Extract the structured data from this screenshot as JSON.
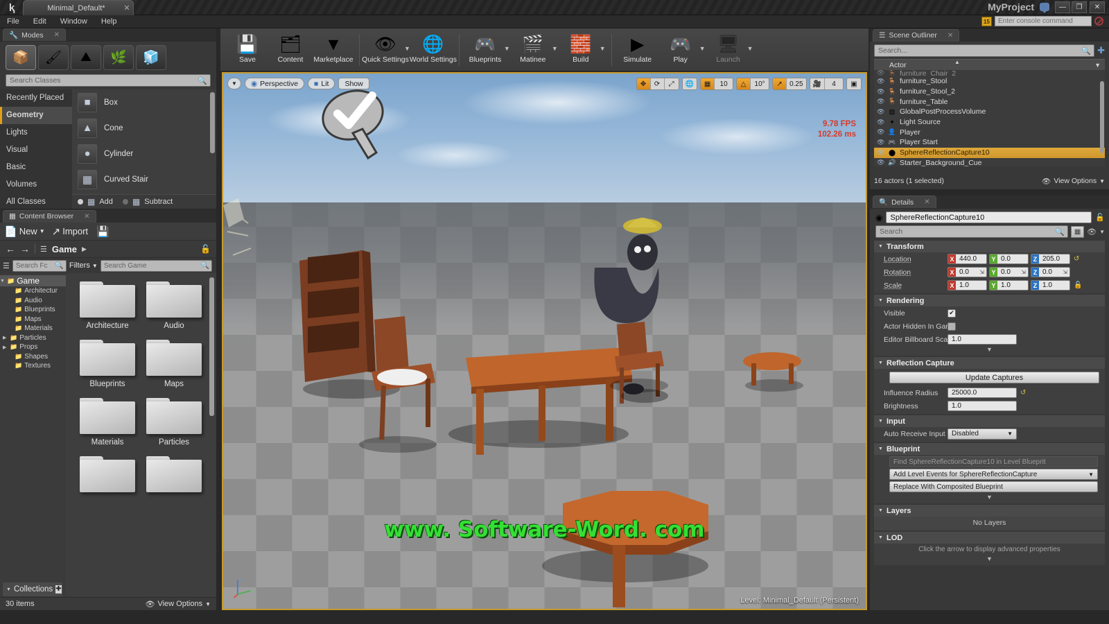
{
  "titlebar": {
    "tab_label": "Minimal_Default*",
    "tab_close": "✕",
    "project_title": "MyProject",
    "minimize": "—",
    "maximize": "❐",
    "close": "✕"
  },
  "menubar": {
    "items": [
      "File",
      "Edit",
      "Window",
      "Help"
    ],
    "console_badge": "15",
    "console_placeholder": "Enter console command"
  },
  "modes": {
    "tab_title": "Modes",
    "tab_close": "✕",
    "mode_buttons": [
      {
        "name": "place-mode",
        "glyph": "📦"
      },
      {
        "name": "paint-mode",
        "glyph": "🖌"
      },
      {
        "name": "landscape-mode",
        "glyph": "⛰"
      },
      {
        "name": "foliage-mode",
        "glyph": "🌿"
      },
      {
        "name": "geometry-editing-mode",
        "glyph": "🧊"
      }
    ],
    "search_placeholder": "Search Classes",
    "categories": [
      {
        "label": "Recently Placed",
        "active": false
      },
      {
        "label": "Geometry",
        "active": true
      },
      {
        "label": "Lights",
        "active": false
      },
      {
        "label": "Visual",
        "active": false
      },
      {
        "label": "Basic",
        "active": false
      },
      {
        "label": "Volumes",
        "active": false
      },
      {
        "label": "All Classes",
        "active": false
      }
    ],
    "items": [
      {
        "label": "Box",
        "glyph": "⬛"
      },
      {
        "label": "Cone",
        "glyph": "▲"
      },
      {
        "label": "Cylinder",
        "glyph": "⬮"
      },
      {
        "label": "Curved Stair",
        "glyph": "▤"
      }
    ],
    "csg_add_label": "Add",
    "csg_subtract_label": "Subtract"
  },
  "content_browser": {
    "tab_title": "Content Browser",
    "tab_close": "✕",
    "new_label": "New",
    "import_label": "Import",
    "save_all_icon": "save-all-icon",
    "path_root": "Game",
    "folder_search_placeholder": "Search Fc",
    "filters_label": "Filters",
    "asset_search_placeholder": "Search Game",
    "tree": [
      {
        "label": "Game",
        "depth": 0,
        "expandable": true
      },
      {
        "label": "Architectur",
        "depth": 1,
        "expandable": false
      },
      {
        "label": "Audio",
        "depth": 1,
        "expandable": false
      },
      {
        "label": "Blueprints",
        "depth": 1,
        "expandable": false
      },
      {
        "label": "Maps",
        "depth": 1,
        "expandable": false
      },
      {
        "label": "Materials",
        "depth": 1,
        "expandable": false
      },
      {
        "label": "Particles",
        "depth": 1,
        "expandable": true
      },
      {
        "label": "Props",
        "depth": 1,
        "expandable": true
      },
      {
        "label": "Shapes",
        "depth": 1,
        "expandable": false
      },
      {
        "label": "Textures",
        "depth": 1,
        "expandable": false
      }
    ],
    "tiles": [
      "Architecture",
      "Audio",
      "Blueprints",
      "Maps",
      "Materials",
      "Particles",
      "",
      ""
    ],
    "collections_label": "Collections",
    "collections_add": "✚",
    "item_count": "30 items",
    "view_options": "View Options"
  },
  "toolbar": {
    "groups": [
      [
        {
          "label": "Save",
          "icon": "save-icon",
          "glyph": "💾",
          "caret": false,
          "disabled": false
        },
        {
          "label": "Content",
          "icon": "content-icon",
          "glyph": "🗂",
          "caret": false,
          "disabled": false
        },
        {
          "label": "Marketplace",
          "icon": "marketplace-icon",
          "glyph": "⬇",
          "caret": false,
          "disabled": false
        }
      ],
      [
        {
          "label": "Quick Settings",
          "icon": "quick-settings-icon",
          "glyph": "👁",
          "caret": true,
          "disabled": false
        },
        {
          "label": "World Settings",
          "icon": "world-settings-icon",
          "glyph": "🌐",
          "caret": false,
          "disabled": false
        }
      ],
      [
        {
          "label": "Blueprints",
          "icon": "blueprints-icon",
          "glyph": "🎮",
          "caret": true,
          "disabled": false
        },
        {
          "label": "Matinee",
          "icon": "matinee-icon",
          "glyph": "🎬",
          "caret": true,
          "disabled": false
        },
        {
          "label": "Build",
          "icon": "build-icon",
          "glyph": "🧱",
          "caret": true,
          "disabled": false
        }
      ],
      [
        {
          "label": "Simulate",
          "icon": "simulate-icon",
          "glyph": "▶",
          "caret": false,
          "disabled": false
        },
        {
          "label": "Play",
          "icon": "play-icon",
          "glyph": "🎮",
          "caret": true,
          "disabled": false
        },
        {
          "label": "Launch",
          "icon": "launch-icon",
          "glyph": "🖥",
          "caret": true,
          "disabled": true
        }
      ]
    ]
  },
  "viewport": {
    "view_mode": "Perspective",
    "lighting_mode": "Lit",
    "show_label": "Show",
    "transform_tools": [
      {
        "name": "translate-tool",
        "glyph": "✥",
        "on": true
      },
      {
        "name": "rotate-tool",
        "glyph": "⟳",
        "on": false
      },
      {
        "name": "scale-tool",
        "glyph": "⤢",
        "on": false
      }
    ],
    "coord_system_glyph": "🌐",
    "grid_snap_glyph": "▦",
    "grid_snap_value": "10",
    "angle_snap_glyph": "△",
    "angle_snap_value": "10°",
    "scale_snap_glyph": "↗",
    "scale_snap_value": "0.25",
    "camera_speed_glyph": "🎥",
    "camera_speed_value": "4",
    "fps": "9.78 FPS",
    "frame_time": "102.26 ms",
    "level_status": "Level:  Minimal_Default (Persistent)",
    "watermark": "www. Software-Word. com"
  },
  "outliner": {
    "tab_title": "Scene Outliner",
    "tab_close": "✕",
    "search_placeholder": "Search...",
    "column_actor": "Actor",
    "actors": [
      {
        "name": "furniture_Chair_2",
        "type_glyph": "🪑",
        "selected": false,
        "partial": true
      },
      {
        "name": "furniture_Stool",
        "type_glyph": "🪑",
        "selected": false
      },
      {
        "name": "furniture_Stool_2",
        "type_glyph": "🪑",
        "selected": false
      },
      {
        "name": "furniture_Table",
        "type_glyph": "🪑",
        "selected": false
      },
      {
        "name": "GlobalPostProcessVolume",
        "type_glyph": "▧",
        "selected": false
      },
      {
        "name": "Light Source",
        "type_glyph": "✦",
        "selected": false
      },
      {
        "name": "Player",
        "type_glyph": "👤",
        "selected": false
      },
      {
        "name": "Player Start",
        "type_glyph": "🎮",
        "selected": false
      },
      {
        "name": "SphereReflectionCapture10",
        "type_glyph": "⬤",
        "selected": true
      },
      {
        "name": "Starter_Background_Cue",
        "type_glyph": "🔊",
        "selected": false
      }
    ],
    "status": "16 actors (1 selected)",
    "view_options": "View Options"
  },
  "details": {
    "tab_title": "Details",
    "tab_close": "✕",
    "actor_name": "SphereReflectionCapture10",
    "search_placeholder": "Search",
    "sections": {
      "transform": {
        "title": "Transform",
        "rows": [
          {
            "label": "Location",
            "x": "440.0",
            "y": "0.0",
            "z": "205.0",
            "spinner": false,
            "reset": true
          },
          {
            "label": "Rotation",
            "x": "0.0",
            "y": "0.0",
            "z": "0.0",
            "spinner": true,
            "reset": false
          },
          {
            "label": "Scale",
            "x": "1.0",
            "y": "1.0",
            "z": "1.0",
            "spinner": false,
            "lock": true
          }
        ]
      },
      "rendering": {
        "title": "Rendering",
        "visible_label": "Visible",
        "visible_checked": true,
        "hidden_label": "Actor Hidden In Gar",
        "hidden_checked": false,
        "billboard_label": "Editor Billboard Sca",
        "billboard_value": "1.0"
      },
      "reflection_capture": {
        "title": "Reflection Capture",
        "update_button": "Update Captures",
        "influence_label": "Influence Radius",
        "influence_value": "25000.0",
        "brightness_label": "Brightness",
        "brightness_value": "1.0"
      },
      "input": {
        "title": "Input",
        "auto_receive_label": "Auto Receive Input",
        "auto_receive_value": "Disabled"
      },
      "blueprint": {
        "title": "Blueprint",
        "buttons": [
          {
            "label": "Find SphereReflectionCapture10 in Level Blueprit",
            "dim": true,
            "dropdown": false
          },
          {
            "label": "Add Level Events for SphereReflectionCapture",
            "dim": false,
            "dropdown": true
          },
          {
            "label": "Replace With Composited Blueprint",
            "dim": false,
            "dropdown": false
          }
        ]
      },
      "layers": {
        "title": "Layers",
        "empty_text": "No Layers"
      },
      "lod": {
        "title": "LOD",
        "advanced_text": "Click the arrow to display advanced properties"
      }
    }
  }
}
